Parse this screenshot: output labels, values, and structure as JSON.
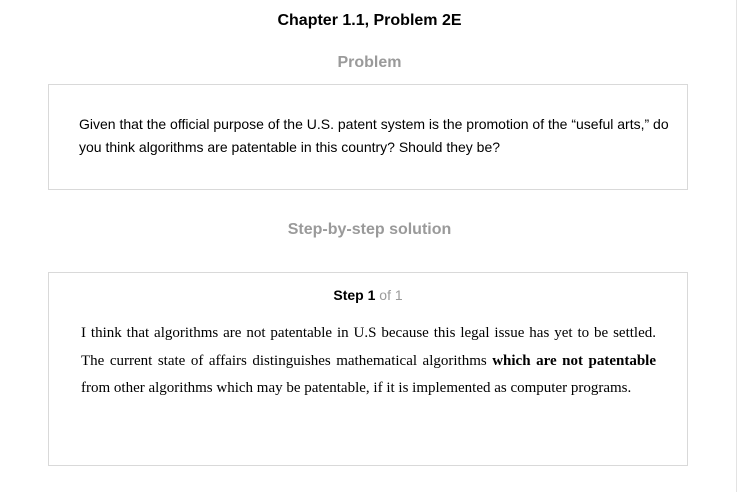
{
  "header": {
    "title": "Chapter 1.1, Problem 2E"
  },
  "problem": {
    "heading": "Problem",
    "text": "Given that the official purpose of the U.S. patent system is the promotion of the “useful arts,” do you think algorithms are patentable in this country? Should they be?"
  },
  "solution": {
    "heading": "Step-by-step solution",
    "step": {
      "label": "Step",
      "number": "1",
      "of_text": "of 1"
    },
    "text_before_bold": "I think that algorithms are not patentable in U.S because this legal issue has yet to be settled. The current state of affairs distinguishes mathematical algorithms ",
    "text_bold": "which are not patentable",
    "text_after_bold": " from other algorithms which may be patentable, if it is implemented as computer programs."
  }
}
